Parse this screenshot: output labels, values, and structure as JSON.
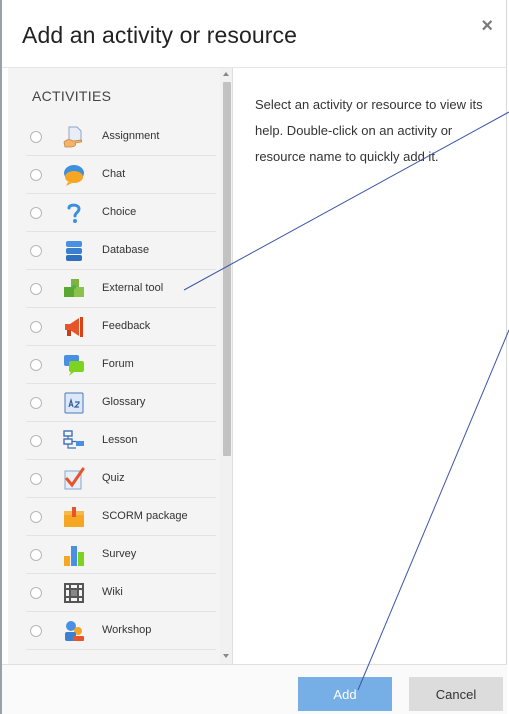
{
  "dialog": {
    "title": "Add an activity or resource",
    "close_symbol": "×"
  },
  "activities": {
    "heading": "ACTIVITIES",
    "items": [
      {
        "label": "Assignment",
        "icon": "assignment-icon"
      },
      {
        "label": "Chat",
        "icon": "chat-icon"
      },
      {
        "label": "Choice",
        "icon": "choice-icon"
      },
      {
        "label": "Database",
        "icon": "database-icon"
      },
      {
        "label": "External tool",
        "icon": "puzzle-icon"
      },
      {
        "label": "Feedback",
        "icon": "megaphone-icon"
      },
      {
        "label": "Forum",
        "icon": "forum-icon"
      },
      {
        "label": "Glossary",
        "icon": "glossary-icon"
      },
      {
        "label": "Lesson",
        "icon": "lesson-icon"
      },
      {
        "label": "Quiz",
        "icon": "quiz-icon"
      },
      {
        "label": "SCORM package",
        "icon": "package-icon"
      },
      {
        "label": "Survey",
        "icon": "survey-icon"
      },
      {
        "label": "Wiki",
        "icon": "wiki-icon"
      },
      {
        "label": "Workshop",
        "icon": "workshop-icon"
      }
    ]
  },
  "help": {
    "text": "Select an activity or resource to view its help. Double-click on an activity or resource name to quickly add it."
  },
  "footer": {
    "add_label": "Add",
    "cancel_label": "Cancel"
  },
  "colors": {
    "add_button": "#76aee6",
    "cancel_button": "#dcdcdc",
    "annotation_line": "#3b55a8"
  }
}
